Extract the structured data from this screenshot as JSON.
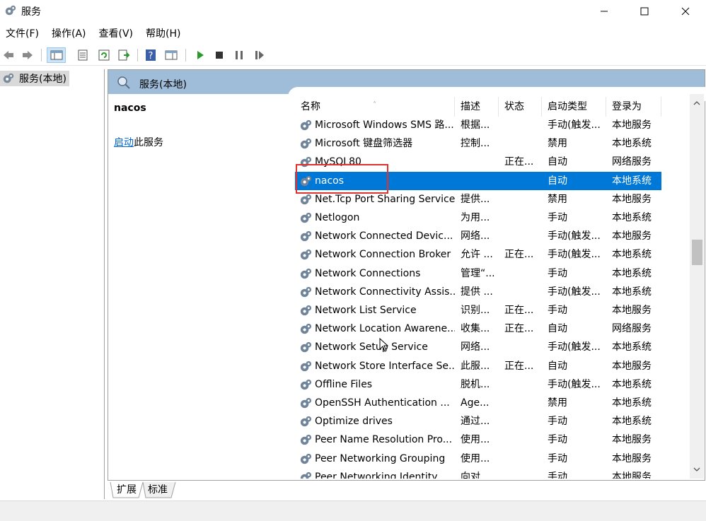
{
  "window": {
    "title": "服务",
    "icon": "gear-icon",
    "controls": [
      "minimize-icon",
      "maximize-icon",
      "close-icon"
    ]
  },
  "menu": [
    "文件(F)",
    "操作(A)",
    "查看(V)",
    "帮助(H)"
  ],
  "toolbar": [
    "back-arrow-icon",
    "forward-arrow-icon",
    "show-hide-console-tree-icon",
    "properties-icon",
    "refresh-icon",
    "export-list-icon",
    "help-icon",
    "show-action-pane-icon",
    "start-service-icon",
    "stop-service-icon",
    "pause-service-icon",
    "restart-service-icon"
  ],
  "tree": {
    "root": "服务(本地)"
  },
  "panel": {
    "header": "服务(本地)",
    "selected_name": "nacos",
    "action_link": "启动",
    "action_rest": "此服务"
  },
  "columns": [
    "名称",
    "描述",
    "状态",
    "启动类型",
    "登录为"
  ],
  "services": [
    {
      "name": "Microsoft Windows SMS 路...",
      "desc": "根据...",
      "status": "",
      "startup": "手动(触发...",
      "logon": "本地服务"
    },
    {
      "name": "Microsoft 键盘筛选器",
      "desc": "控制...",
      "status": "",
      "startup": "禁用",
      "logon": "本地系统"
    },
    {
      "name": "MySQL80",
      "desc": "",
      "status": "正在...",
      "startup": "自动",
      "logon": "网络服务"
    },
    {
      "name": "nacos",
      "desc": "",
      "status": "",
      "startup": "自动",
      "logon": "本地系统"
    },
    {
      "name": "Net.Tcp Port Sharing Service",
      "desc": "提供...",
      "status": "",
      "startup": "禁用",
      "logon": "本地服务"
    },
    {
      "name": "Netlogon",
      "desc": "为用...",
      "status": "",
      "startup": "手动",
      "logon": "本地系统"
    },
    {
      "name": "Network Connected Devic...",
      "desc": "网络...",
      "status": "",
      "startup": "手动(触发...",
      "logon": "本地服务"
    },
    {
      "name": "Network Connection Broker",
      "desc": "允许 ...",
      "status": "正在...",
      "startup": "手动(触发...",
      "logon": "本地系统"
    },
    {
      "name": "Network Connections",
      "desc": "管理“...",
      "status": "",
      "startup": "手动",
      "logon": "本地系统"
    },
    {
      "name": "Network Connectivity Assis...",
      "desc": "提供 ...",
      "status": "",
      "startup": "手动(触发...",
      "logon": "本地系统"
    },
    {
      "name": "Network List Service",
      "desc": "识别...",
      "status": "正在...",
      "startup": "手动",
      "logon": "本地服务"
    },
    {
      "name": "Network Location Awarene...",
      "desc": "收集...",
      "status": "正在...",
      "startup": "自动",
      "logon": "网络服务"
    },
    {
      "name": "Network Setup Service",
      "desc": "网络...",
      "status": "",
      "startup": "手动(触发...",
      "logon": "本地系统"
    },
    {
      "name": "Network Store Interface Se...",
      "desc": "此服...",
      "status": "正在...",
      "startup": "自动",
      "logon": "本地服务"
    },
    {
      "name": "Offline Files",
      "desc": "脱机...",
      "status": "",
      "startup": "手动(触发...",
      "logon": "本地系统"
    },
    {
      "name": "OpenSSH Authentication ...",
      "desc": "Age...",
      "status": "",
      "startup": "禁用",
      "logon": "本地系统"
    },
    {
      "name": "Optimize drives",
      "desc": "通过...",
      "status": "",
      "startup": "手动",
      "logon": "本地系统"
    },
    {
      "name": "Peer Name Resolution Pro...",
      "desc": "使用...",
      "status": "",
      "startup": "手动",
      "logon": "本地服务"
    },
    {
      "name": "Peer Networking Grouping",
      "desc": "使用...",
      "status": "",
      "startup": "手动",
      "logon": "本地服务"
    },
    {
      "name": "Peer Networking Identity ...",
      "desc": "向对...",
      "status": "",
      "startup": "手动",
      "logon": "本地服务"
    }
  ],
  "selected_row": 3,
  "tabs": [
    "扩展",
    "标准"
  ],
  "active_tab": 0,
  "colors": {
    "selection": "#0078d7",
    "panel_header": "#9fbcd8",
    "highlight_box": "#e03030",
    "link": "#0066cc"
  }
}
